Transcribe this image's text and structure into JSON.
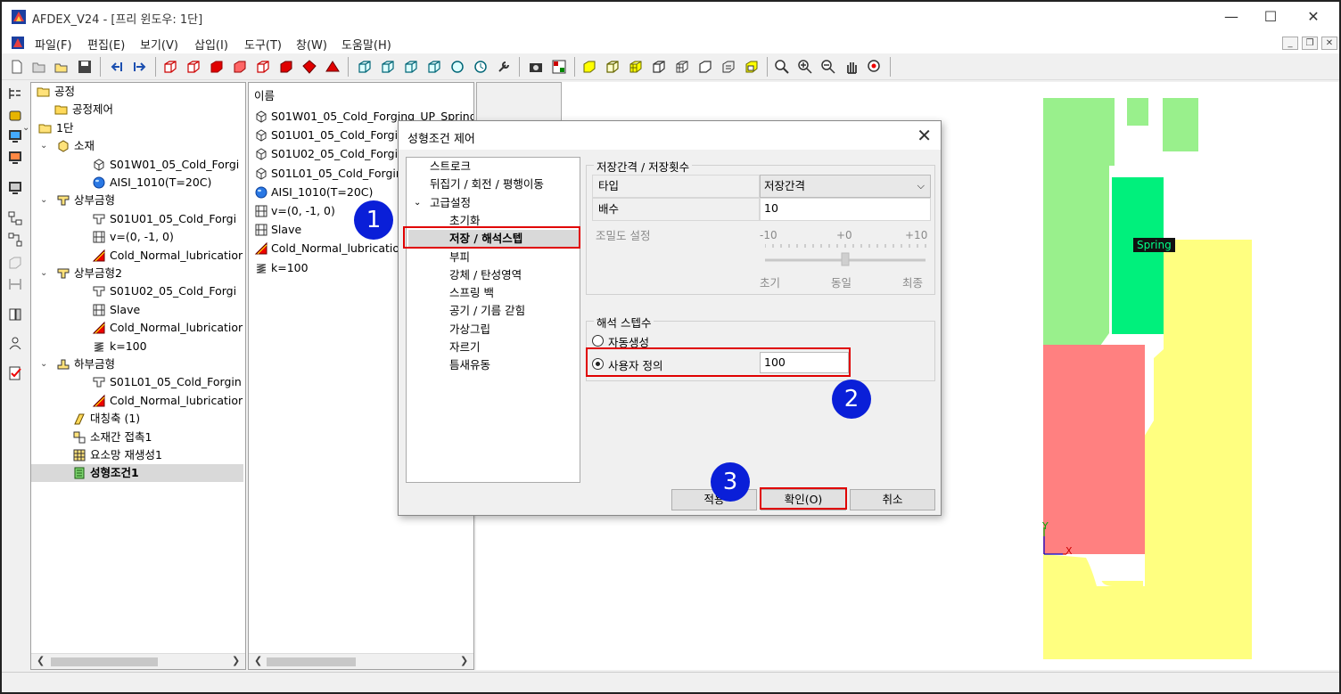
{
  "app": {
    "title": "AFDEX_V24 - [프리 윈도우: 1단]",
    "controls": {
      "minimize": "—",
      "maximize": "☐",
      "close": "✕"
    }
  },
  "menu": [
    "파일(F)",
    "편집(E)",
    "보기(V)",
    "삽입(I)",
    "도구(T)",
    "창(W)",
    "도움말(H)"
  ],
  "tree": {
    "items": [
      {
        "label": "공정",
        "icon": "folder-open-icon"
      },
      {
        "label": "공정제어",
        "icon": "folder-icon"
      },
      {
        "label": "1단",
        "icon": "folder-open-icon"
      },
      {
        "label": "소재",
        "icon": "workpiece-icon"
      },
      {
        "label": "S01W01_05_Cold_Forgi",
        "icon": "mesh-icon"
      },
      {
        "label": "AISI_1010(T=20C)",
        "icon": "material-icon"
      },
      {
        "label": "상부금형",
        "icon": "upper-die-icon"
      },
      {
        "label": "S01U01_05_Cold_Forgi",
        "icon": "die-mesh-icon"
      },
      {
        "label": "v=(0, -1, 0)",
        "icon": "velocity-icon"
      },
      {
        "label": "Cold_Normal_lubricatior",
        "icon": "lubrication-icon"
      },
      {
        "label": "상부금형2",
        "icon": "upper-die-icon"
      },
      {
        "label": "S01U02_05_Cold_Forgi",
        "icon": "die-mesh-icon"
      },
      {
        "label": "Slave",
        "icon": "velocity-icon"
      },
      {
        "label": "Cold_Normal_lubricatior",
        "icon": "lubrication-icon"
      },
      {
        "label": "k=100",
        "icon": "spring-icon"
      },
      {
        "label": "하부금형",
        "icon": "lower-die-icon"
      },
      {
        "label": "S01L01_05_Cold_Forgin",
        "icon": "die-mesh-icon"
      },
      {
        "label": "Cold_Normal_lubricatior",
        "icon": "lubrication-icon"
      },
      {
        "label": "대칭축 (1)",
        "icon": "symmetry-icon"
      },
      {
        "label": "소재간 접촉1",
        "icon": "contact-icon"
      },
      {
        "label": "요소망 재생성1",
        "icon": "remesh-icon"
      },
      {
        "label": "성형조건1",
        "icon": "condition-icon"
      }
    ]
  },
  "list": {
    "header": "이름",
    "items": [
      {
        "label": "S01W01_05_Cold_Forging_UP_Spring",
        "icon": "mesh-icon"
      },
      {
        "label": "S01U01_05_Cold_Forgin",
        "icon": "mesh-icon"
      },
      {
        "label": "S01U02_05_Cold_Forgin",
        "icon": "mesh-icon"
      },
      {
        "label": "S01L01_05_Cold_Forgin",
        "icon": "mesh-icon"
      },
      {
        "label": "AISI_1010(T=20C)",
        "icon": "material-icon"
      },
      {
        "label": "v=(0, -1, 0)",
        "icon": "velocity-icon"
      },
      {
        "label": "Slave",
        "icon": "velocity-icon"
      },
      {
        "label": "Cold_Normal_lubrication",
        "icon": "lubrication-icon"
      },
      {
        "label": "k=100",
        "icon": "spring-icon"
      }
    ]
  },
  "viewport": {
    "spring_label": "Spring",
    "axis_y": "Y",
    "axis_x": "X",
    "colors": {
      "green": "#99f08c",
      "spring": "#00f07c",
      "red": "#ff8080",
      "yellow": "#ffff80"
    }
  },
  "dialog": {
    "title": "성형조건 제어",
    "tree": [
      {
        "label": "스트로크",
        "level": 0
      },
      {
        "label": "뒤집기 / 회전 / 평행이동",
        "level": 0
      },
      {
        "label": "고급설정",
        "level": 0,
        "expanded": true
      },
      {
        "label": "초기화",
        "level": 1
      },
      {
        "label": "저장 / 해석스텝",
        "level": 1,
        "selected": true
      },
      {
        "label": "부피",
        "level": 1
      },
      {
        "label": "강체 / 탄성영역",
        "level": 1
      },
      {
        "label": "스프링 백",
        "level": 1
      },
      {
        "label": "공기 / 기름 갇힘",
        "level": 1
      },
      {
        "label": "가상그립",
        "level": 1
      },
      {
        "label": "자르기",
        "level": 1
      },
      {
        "label": "틈새유동",
        "level": 1
      }
    ],
    "save_group": {
      "title": "저장간격 / 저장횟수",
      "type_label": "타입",
      "type_value": "저장간격",
      "multiplier_label": "배수",
      "multiplier_value": "10",
      "density_label": "조밀도 설정",
      "density_ticks": [
        "-10",
        "+0",
        "+10"
      ],
      "density_marks": [
        "초기",
        "동일",
        "최종"
      ],
      "density_value": 0
    },
    "steps_group": {
      "title": "해석 스텝수",
      "auto_label": "자동생성",
      "user_label": "사용자 정의",
      "user_value": "100",
      "selected": "user"
    },
    "buttons": {
      "apply": "적용",
      "ok": "확인(O)",
      "cancel": "취소"
    }
  },
  "annotations": {
    "badge1": "1",
    "badge2": "2",
    "badge3": "3",
    "highlight_color": "#e00000",
    "badge_color": "#0a1fd8"
  }
}
